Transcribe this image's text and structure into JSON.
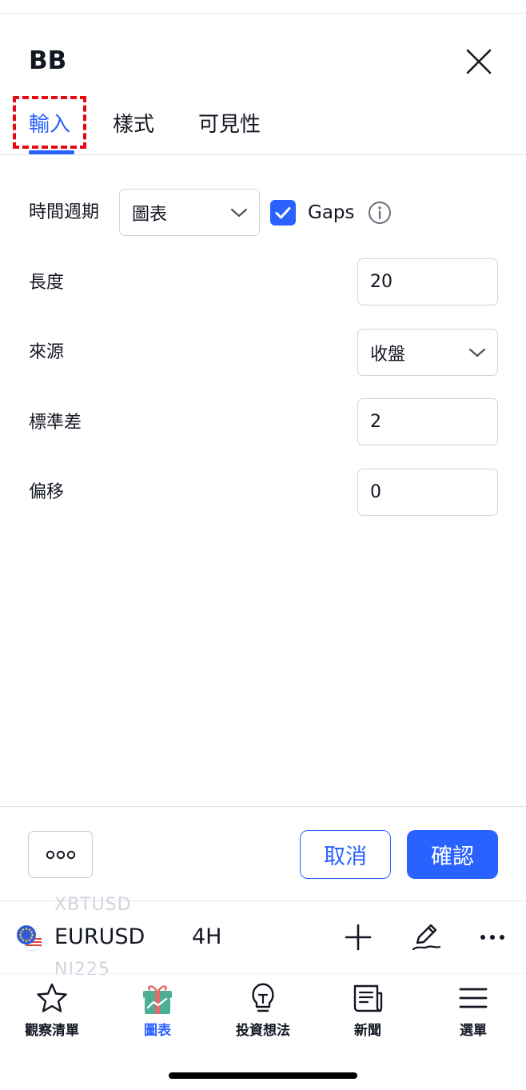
{
  "dialog": {
    "title": "BB",
    "tabs": [
      {
        "label": "輸入",
        "active": true
      },
      {
        "label": "樣式",
        "active": false
      },
      {
        "label": "可見性",
        "active": false
      }
    ]
  },
  "inputs": {
    "timeframe": {
      "label": "時間週期",
      "value": "圖表",
      "gaps_label": "Gaps",
      "gaps_checked": true
    },
    "length": {
      "label": "長度",
      "value": "20"
    },
    "source": {
      "label": "來源",
      "value": "收盤"
    },
    "stddev": {
      "label": "標準差",
      "value": "2"
    },
    "offset": {
      "label": "偏移",
      "value": "0"
    }
  },
  "footer": {
    "more_label": "ooo",
    "cancel_label": "取消",
    "confirm_label": "確認"
  },
  "toolbar": {
    "prev_symbol": "XBTUSD",
    "symbol": "EURUSD",
    "interval": "4H",
    "next_symbol": "NI225"
  },
  "nav": [
    {
      "label": "觀察清單",
      "icon": "star-icon",
      "active": false
    },
    {
      "label": "圖表",
      "icon": "chart-gift-icon",
      "active": true
    },
    {
      "label": "投資想法",
      "icon": "lightbulb-icon",
      "active": false
    },
    {
      "label": "新聞",
      "icon": "news-icon",
      "active": false
    },
    {
      "label": "選單",
      "icon": "menu-icon",
      "active": false
    }
  ],
  "colors": {
    "accent": "#2962ff",
    "highlight": "#e50914",
    "text": "#131722",
    "border": "#d1d4dc",
    "gift": "#4caf93"
  }
}
